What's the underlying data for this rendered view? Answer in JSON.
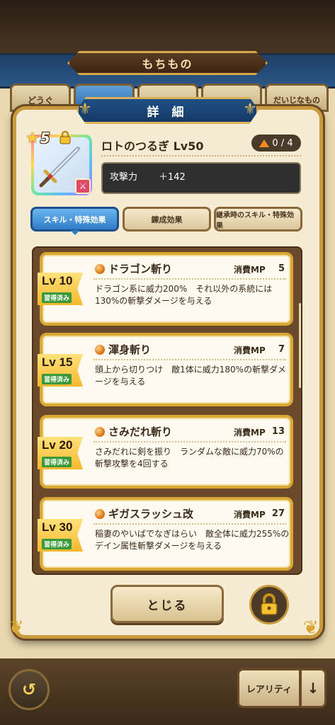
{
  "background": {
    "title": "もちもの",
    "tabs": [
      {
        "label": "どうぐ"
      },
      {
        "label": ""
      },
      {
        "label": ""
      },
      {
        "label": ""
      },
      {
        "label": "だいじなもの"
      }
    ]
  },
  "dialog": {
    "title": "詳 細",
    "item": {
      "rarity": "5",
      "name": "ロトのつるぎ Lv50",
      "upgrade": "0 / 4",
      "stat_label": "攻撃力",
      "stat_value": "＋142"
    },
    "tabs": [
      {
        "label": "スキル・特殊効果"
      },
      {
        "label": "錬成効果"
      },
      {
        "label": "継承時のスキル・特殊効果"
      }
    ],
    "skills": [
      {
        "level": "Lv 10",
        "learned": "習得済み",
        "name": "ドラゴン斬り",
        "mp_label": "消費MP",
        "mp": "5",
        "desc": "ドラゴン系に威力200%　それ以外の系統には130%の斬撃ダメージを与える"
      },
      {
        "level": "Lv 15",
        "learned": "習得済み",
        "name": "渾身斬り",
        "mp_label": "消費MP",
        "mp": "7",
        "desc": "頭上から切りつけ　敵1体に威力180%の斬撃ダメージを与える"
      },
      {
        "level": "Lv 20",
        "learned": "習得済み",
        "name": "さみだれ斬り",
        "mp_label": "消費MP",
        "mp": "13",
        "desc": "さみだれに剣を振り　ランダムな敵に威力70%の斬撃攻撃を4回する"
      },
      {
        "level": "Lv 30",
        "learned": "習得済み",
        "name": "ギガスラッシュ改",
        "mp_label": "消費MP",
        "mp": "27",
        "desc": "稲妻のやいばでなぎはらい　敵全体に威力255%のデイン属性斬撃ダメージを与える"
      }
    ],
    "close_label": "とじる"
  },
  "footer": {
    "rarity_label": "レアリティ",
    "sort_icon": "↓"
  },
  "colors": {
    "accent_gold": "#d9a733",
    "tab_active_blue": "#2f7cc8",
    "banner_blue": "#1f4f86",
    "learned_green": "#3a9a3a"
  }
}
